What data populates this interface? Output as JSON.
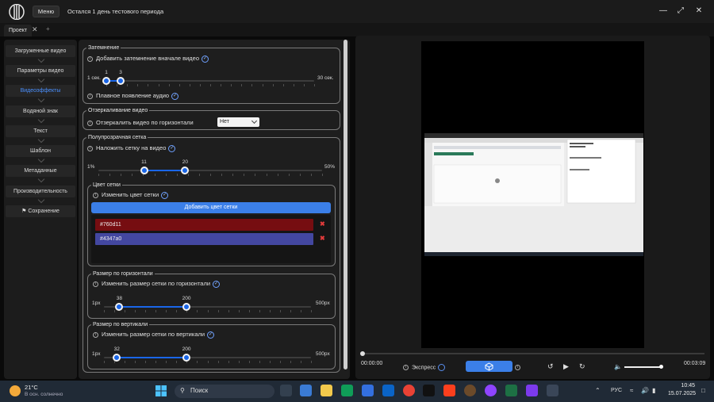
{
  "titlebar": {
    "menu_label": "Меню",
    "trial_text": "Остался 1 день тестового периода"
  },
  "tabs": [
    {
      "label": "Проект"
    }
  ],
  "sidebar": {
    "items": [
      {
        "label": "Загруженные видео"
      },
      {
        "label": "Параметры видео"
      },
      {
        "label": "Видеоэффекты",
        "active": true
      },
      {
        "label": "Водяной знак"
      },
      {
        "label": "Текст"
      },
      {
        "label": "Шаблон"
      },
      {
        "label": "Метаданные"
      },
      {
        "label": "Производительность"
      },
      {
        "label": "Сохранение",
        "icon": "flag-icon"
      }
    ]
  },
  "fade": {
    "legend": "Затемнение",
    "checkbox_label": "Добавить затемнение вначале видео",
    "range_min": "1 сек.",
    "range_max": "30 сек.",
    "low_value": "1",
    "high_value": "3",
    "low": 1,
    "high": 3,
    "min": 1,
    "max": 30,
    "audio_label": "Плавное появление аудио"
  },
  "mirror": {
    "legend": "Отзеркаливание видео",
    "label": "Отзеркалить видео по горизонтали",
    "selected": "Нет"
  },
  "grid": {
    "legend": "Полупрозрачная сетка",
    "checkbox_label": "Наложить сетку на видео",
    "range_min": "1%",
    "range_max": "50%",
    "low_value": "11",
    "high_value": "20",
    "low": 11,
    "high": 20,
    "min": 1,
    "max": 50,
    "colors": {
      "legend": "Цвет сетки",
      "checkbox_label": "Изменить цвет сетки",
      "add_button": "Добавить цвет сетки",
      "items": [
        {
          "hex": "#760d11"
        },
        {
          "hex": "#4347a0"
        }
      ]
    },
    "horizontal": {
      "legend": "Размер по горизонтали",
      "checkbox_label": "Изменить размер сетки по горизонтали",
      "range_min": "1px",
      "range_max": "500px",
      "low_value": "38",
      "high_value": "200",
      "low": 38,
      "high": 200,
      "min": 1,
      "max": 500
    },
    "vertical": {
      "legend": "Размер по вертикали",
      "checkbox_label": "Изменить размер сетки по вертикали",
      "range_min": "1px",
      "range_max": "500px",
      "low_value": "32",
      "high_value": "200",
      "low": 32,
      "high": 200,
      "min": 1,
      "max": 500
    }
  },
  "player": {
    "time_start": "00:00:00",
    "time_end": "00:03:09",
    "express_label": "Экспресс",
    "progress": 0,
    "volume": 0.95
  },
  "taskbar": {
    "weather_temp": "21°C",
    "weather_desc": "В осн. солнечно",
    "search_label": "Поиск",
    "language": "РУС",
    "time": "10:45",
    "date": "15.07.2025"
  },
  "colors": {
    "accent": "#1a66e8",
    "button": "#3b7fe8",
    "grid_color_1": "#760d11",
    "grid_color_2": "#4347a0"
  }
}
